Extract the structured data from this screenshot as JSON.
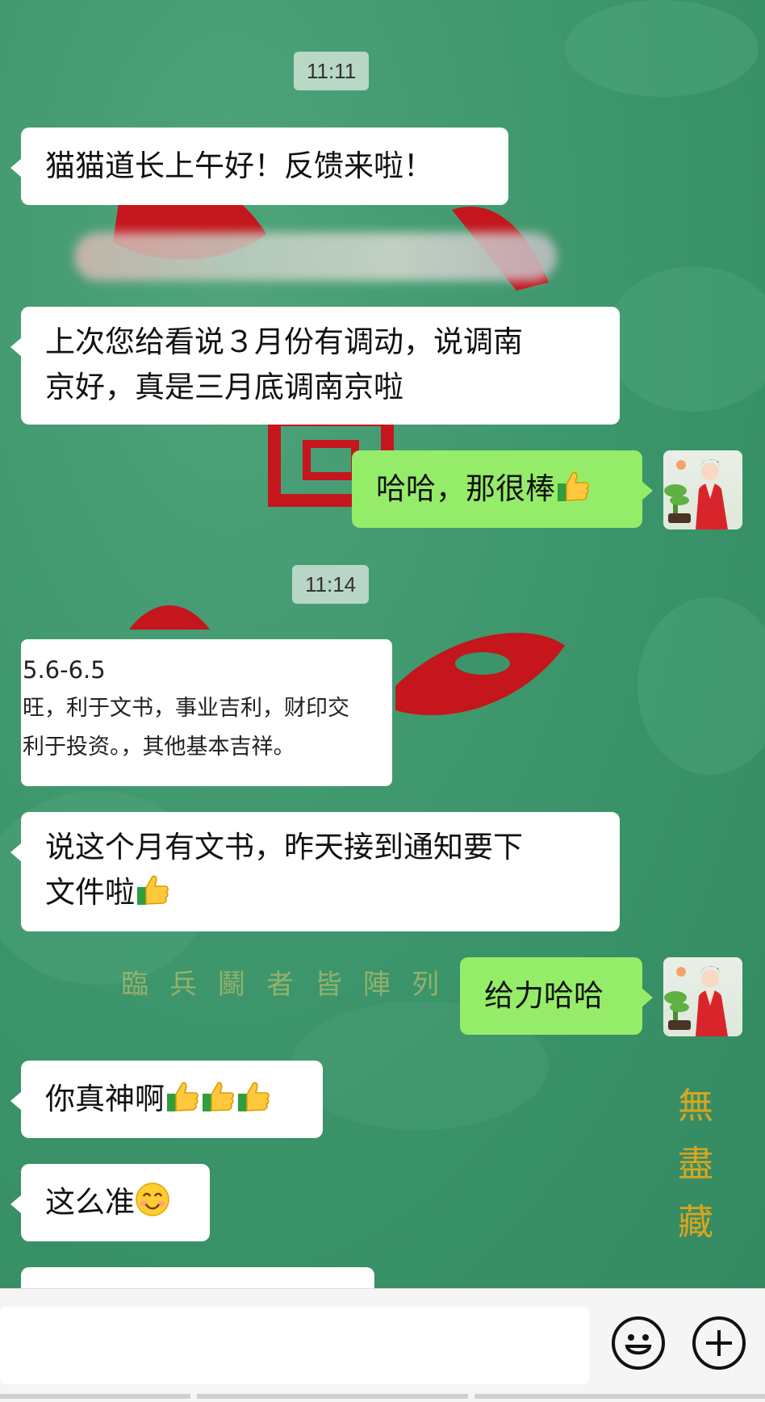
{
  "times": [
    "11:11",
    "11:14"
  ],
  "messages": {
    "m1": "猫猫道长上午好！反馈来啦！",
    "m2_line1": "上次您给看说３月份有调动，说调南",
    "m2_line2": "京好，真是三月底调南京啦",
    "m3": "哈哈，那很棒",
    "m5_line1": "说这个月有文书，昨天接到通知要下",
    "m5_line2": "文件啦",
    "m6": "给力哈哈",
    "m7": "你真神啊",
    "m8": "这么准"
  },
  "image_card": {
    "line1": "5.6-6.5",
    "line2": "旺，利于文书，事业吉利，财印交",
    "line3": "利于投资。，其他基本吉祥。"
  },
  "background_text": {
    "row": "臨兵鬬者皆陣列",
    "vertical": "無盡藏"
  },
  "colors": {
    "chat_background": "#3b946a",
    "incoming_bubble": "#ffffff",
    "outgoing_bubble": "#95ec69"
  },
  "icons": [
    "thumbs-up-icon",
    "smile-emoji-icon",
    "emoji-icon",
    "plus-icon",
    "avatar"
  ]
}
